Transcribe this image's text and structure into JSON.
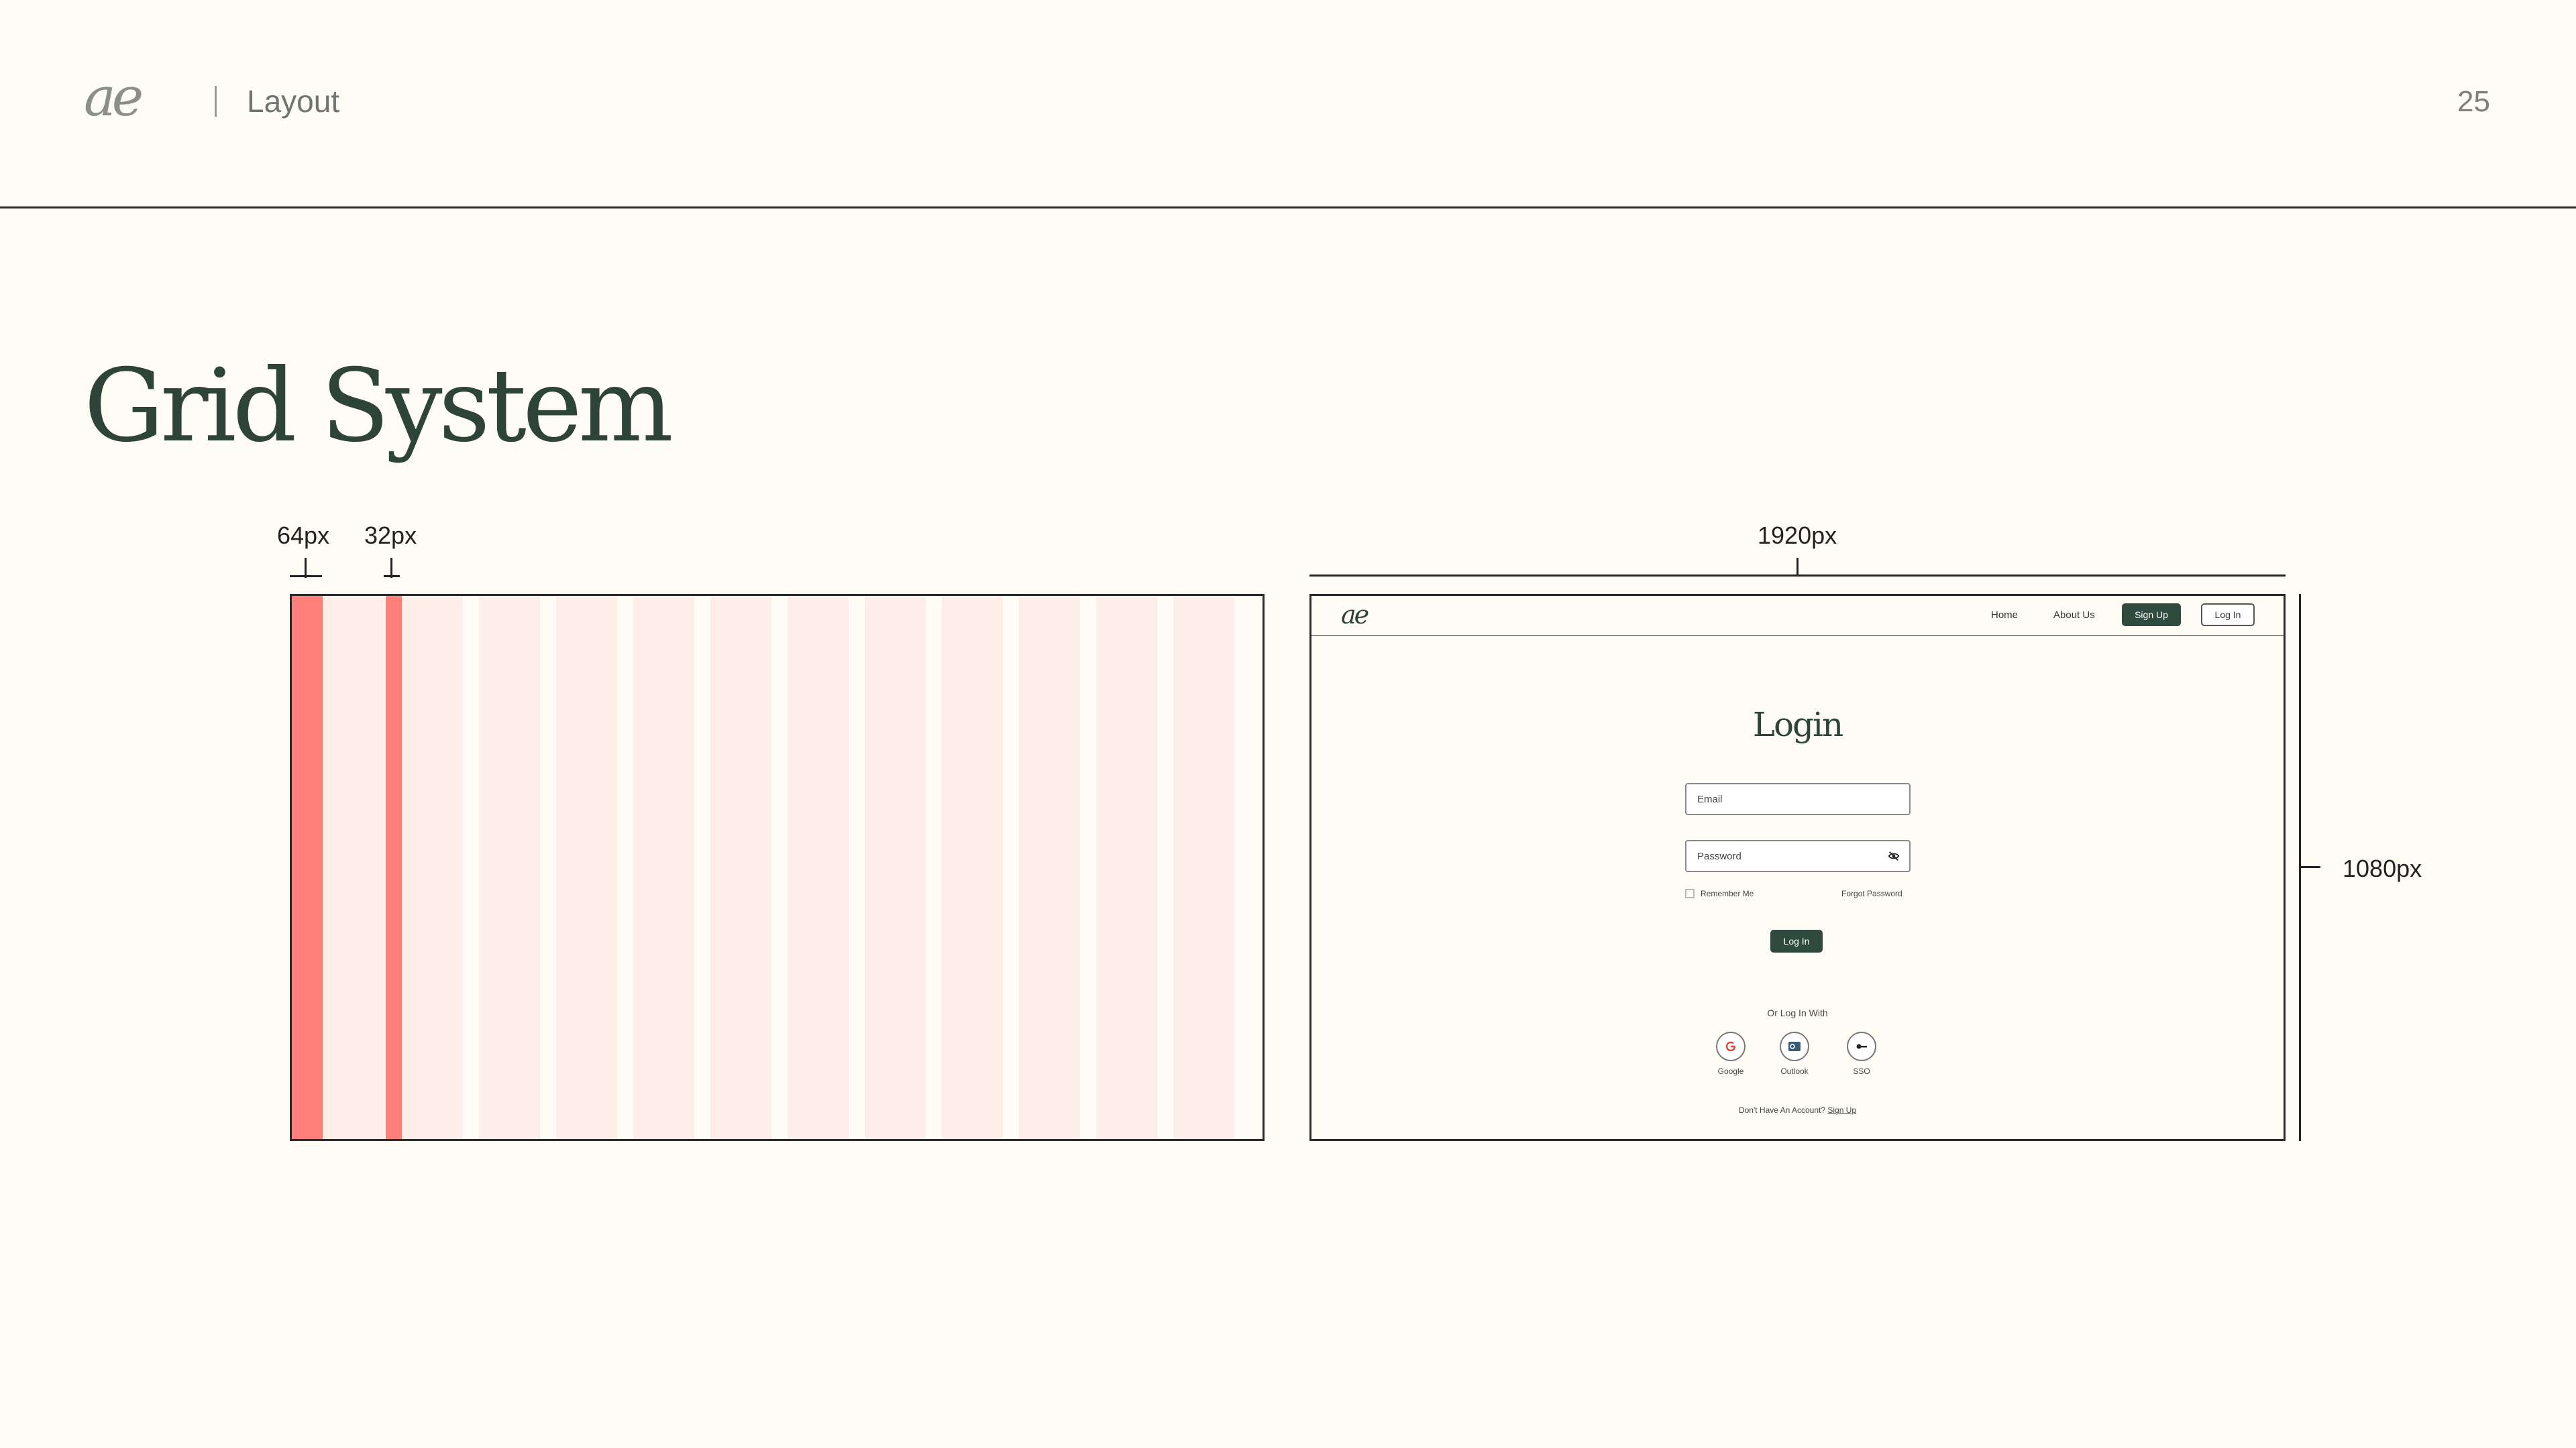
{
  "header": {
    "logo_text": "ae",
    "section": "Layout",
    "page_number": "25"
  },
  "title": "Grid System",
  "grid_diagram": {
    "margin_label": "64px",
    "gutter_label": "32px"
  },
  "mockup": {
    "width_label": "1920px",
    "height_label": "1080px",
    "logo_text": "ae",
    "nav": {
      "home": "Home",
      "about": "About Us",
      "signup": "Sign Up",
      "login": "Log In"
    },
    "login_title": "Login",
    "email_placeholder": "Email",
    "password_placeholder": "Password",
    "remember": "Remember Me",
    "forgot": "Forgot Password",
    "submit": "Log In",
    "alt_heading": "Or Log In With",
    "providers": {
      "google": "Google",
      "outlook": "Outlook",
      "sso": "SSO"
    },
    "no_account": "Don't Have An Account?",
    "signup_link": "Sign Up"
  },
  "colors": {
    "accent": "#2f4a3e",
    "margin_red": "#ff7f7b",
    "column_pink": "#fdeee8",
    "background": "#fffcf6"
  }
}
